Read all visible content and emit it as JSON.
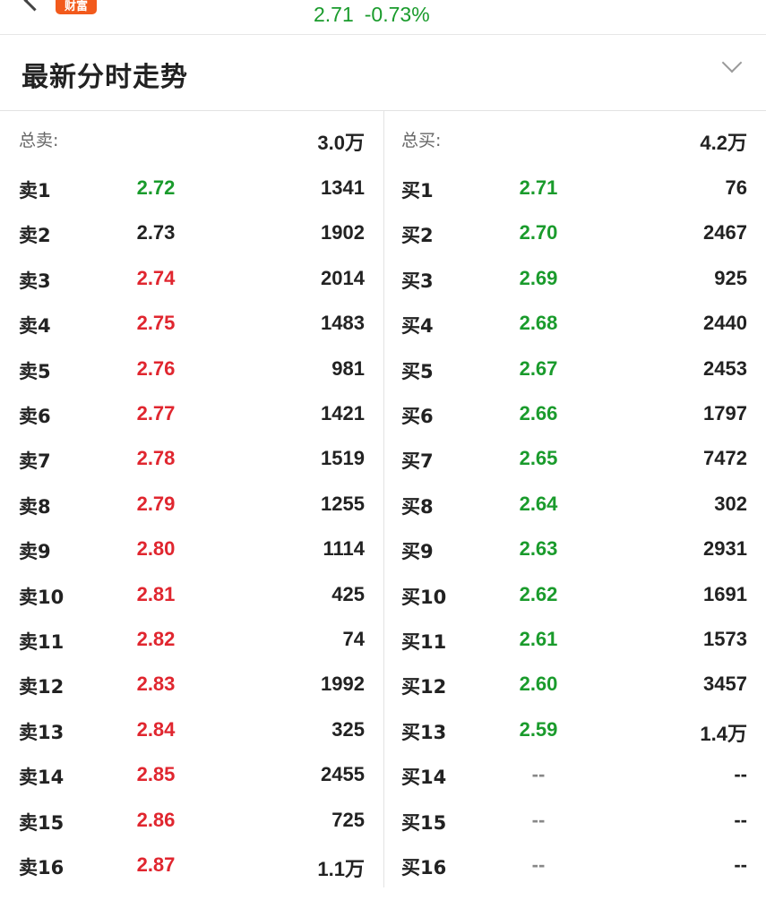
{
  "header": {
    "brand_badge": "财富",
    "price": "2.71",
    "change": "-0.73%",
    "colors": {
      "up": "#e0262f",
      "down": "#1a9b2c",
      "brand": "#f25a1c"
    }
  },
  "section": {
    "title": "最新分时走势"
  },
  "sell": {
    "total_label": "总卖:",
    "total_value": "3.0万",
    "levels": [
      {
        "label": "卖1",
        "price": "2.72",
        "volume": "1341",
        "color": "green"
      },
      {
        "label": "卖2",
        "price": "2.73",
        "volume": "1902",
        "color": "gray"
      },
      {
        "label": "卖3",
        "price": "2.74",
        "volume": "2014",
        "color": "red"
      },
      {
        "label": "卖4",
        "price": "2.75",
        "volume": "1483",
        "color": "red"
      },
      {
        "label": "卖5",
        "price": "2.76",
        "volume": "981",
        "color": "red"
      },
      {
        "label": "卖6",
        "price": "2.77",
        "volume": "1421",
        "color": "red"
      },
      {
        "label": "卖7",
        "price": "2.78",
        "volume": "1519",
        "color": "red"
      },
      {
        "label": "卖8",
        "price": "2.79",
        "volume": "1255",
        "color": "red"
      },
      {
        "label": "卖9",
        "price": "2.80",
        "volume": "1114",
        "color": "red"
      },
      {
        "label": "卖10",
        "price": "2.81",
        "volume": "425",
        "color": "red"
      },
      {
        "label": "卖11",
        "price": "2.82",
        "volume": "74",
        "color": "red"
      },
      {
        "label": "卖12",
        "price": "2.83",
        "volume": "1992",
        "color": "red"
      },
      {
        "label": "卖13",
        "price": "2.84",
        "volume": "325",
        "color": "red"
      },
      {
        "label": "卖14",
        "price": "2.85",
        "volume": "2455",
        "color": "red"
      },
      {
        "label": "卖15",
        "price": "2.86",
        "volume": "725",
        "color": "red"
      },
      {
        "label": "卖16",
        "price": "2.87",
        "volume": "1.1万",
        "color": "red"
      }
    ]
  },
  "buy": {
    "total_label": "总买:",
    "total_value": "4.2万",
    "levels": [
      {
        "label": "买1",
        "price": "2.71",
        "volume": "76",
        "color": "green"
      },
      {
        "label": "买2",
        "price": "2.70",
        "volume": "2467",
        "color": "green"
      },
      {
        "label": "买3",
        "price": "2.69",
        "volume": "925",
        "color": "green"
      },
      {
        "label": "买4",
        "price": "2.68",
        "volume": "2440",
        "color": "green"
      },
      {
        "label": "买5",
        "price": "2.67",
        "volume": "2453",
        "color": "green"
      },
      {
        "label": "买6",
        "price": "2.66",
        "volume": "1797",
        "color": "green"
      },
      {
        "label": "买7",
        "price": "2.65",
        "volume": "7472",
        "color": "green"
      },
      {
        "label": "买8",
        "price": "2.64",
        "volume": "302",
        "color": "green"
      },
      {
        "label": "买9",
        "price": "2.63",
        "volume": "2931",
        "color": "green"
      },
      {
        "label": "买10",
        "price": "2.62",
        "volume": "1691",
        "color": "green"
      },
      {
        "label": "买11",
        "price": "2.61",
        "volume": "1573",
        "color": "green"
      },
      {
        "label": "买12",
        "price": "2.60",
        "volume": "3457",
        "color": "green"
      },
      {
        "label": "买13",
        "price": "2.59",
        "volume": "1.4万",
        "color": "green"
      },
      {
        "label": "买14",
        "price": "--",
        "volume": "--",
        "color": "dash"
      },
      {
        "label": "买15",
        "price": "--",
        "volume": "--",
        "color": "dash"
      },
      {
        "label": "买16",
        "price": "--",
        "volume": "--",
        "color": "dash"
      }
    ]
  }
}
